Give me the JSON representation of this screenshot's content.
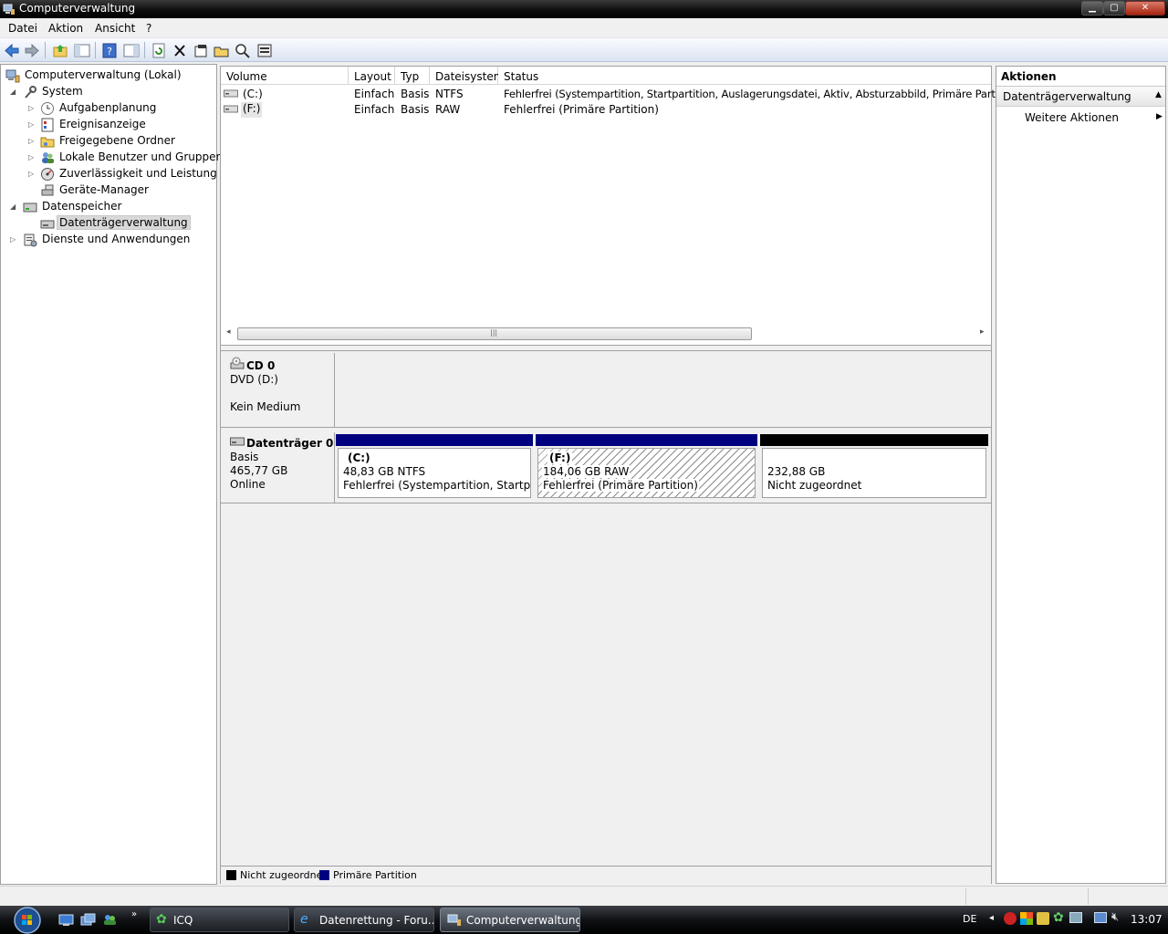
{
  "window": {
    "title": "Computerverwaltung"
  },
  "menu": [
    "Datei",
    "Aktion",
    "Ansicht",
    "?"
  ],
  "tree": {
    "root": "Computerverwaltung (Lokal)",
    "items": [
      {
        "label": "System"
      },
      {
        "label": "Aufgabenplanung"
      },
      {
        "label": "Ereignisanzeige"
      },
      {
        "label": "Freigegebene Ordner"
      },
      {
        "label": "Lokale Benutzer und Gruppen"
      },
      {
        "label": "Zuverlässigkeit und Leistung"
      },
      {
        "label": "Geräte-Manager"
      },
      {
        "label": "Datenspeicher"
      },
      {
        "label": "Datenträgerverwaltung"
      },
      {
        "label": "Dienste und Anwendungen"
      }
    ]
  },
  "volumes": {
    "columns": [
      "Volume",
      "Layout",
      "Typ",
      "Dateisystem",
      "Status"
    ],
    "rows": [
      {
        "volume": "(C:)",
        "layout": "Einfach",
        "typ": "Basis",
        "fs": "NTFS",
        "status": "Fehlerfrei (Systempartition, Startpartition, Auslagerungsdatei, Aktiv, Absturzabbild, Primäre Partition)"
      },
      {
        "volume": "(F:)",
        "layout": "Einfach",
        "typ": "Basis",
        "fs": "RAW",
        "status": "Fehlerfrei (Primäre Partition)"
      }
    ]
  },
  "disks": {
    "cd": {
      "name": "CD 0",
      "type": "DVD (D:)",
      "media": "Kein Medium"
    },
    "disk0": {
      "name": "Datenträger 0",
      "kind": "Basis",
      "size": "465,77 GB",
      "state": "Online",
      "partitions": [
        {
          "label": "(C:)",
          "size": "48,83 GB NTFS",
          "status": "Fehlerfrei (Systempartition, Startpartitio"
        },
        {
          "label": "(F:)",
          "size": "184,06 GB RAW",
          "status": "Fehlerfrei (Primäre Partition)"
        },
        {
          "label": "",
          "size": "232,88 GB",
          "status": "Nicht zugeordnet"
        }
      ]
    }
  },
  "legend": [
    {
      "label": "Nicht zugeordnet",
      "color": "#000000"
    },
    {
      "label": "Primäre Partition",
      "color": "#00007f"
    }
  ],
  "actions": {
    "title": "Aktionen",
    "section": "Datenträgerverwaltung",
    "more": "Weitere Aktionen"
  },
  "taskbar": {
    "tasks": [
      "ICQ",
      "Datenrettung - Foru...",
      "Computerverwaltung"
    ],
    "lang": "DE",
    "clock": "13:07"
  },
  "colors": {
    "primary_partition": "#00007f",
    "unallocated": "#000000",
    "selection": "#d9d9d9"
  }
}
